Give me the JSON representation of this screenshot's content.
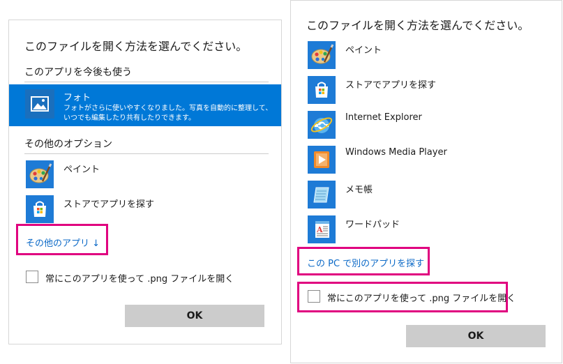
{
  "left_dialog": {
    "title": "このファイルを開く方法を選んでください。",
    "keep_section": "このアプリを今後も使う",
    "selected_app": {
      "name": "フォト",
      "description": "フォトがさらに使いやすくなりました。写真を自動的に整理して、いつでも編集したり共有したりできます。",
      "icon": "photos-icon"
    },
    "other_section": "その他のオプション",
    "apps": [
      {
        "name": "ペイント",
        "icon": "paint-icon"
      },
      {
        "name": "ストアでアプリを探す",
        "icon": "store-icon"
      }
    ],
    "more_apps_link": "その他のアプリ ↓",
    "always_use_label": "常にこのアプリを使って .png ファイルを開く",
    "ok_label": "OK"
  },
  "right_dialog": {
    "title": "このファイルを開く方法を選んでください。",
    "apps": [
      {
        "name": "ペイント",
        "icon": "paint-icon"
      },
      {
        "name": "ストアでアプリを探す",
        "icon": "store-icon"
      },
      {
        "name": "Internet Explorer",
        "icon": "internet-explorer-icon"
      },
      {
        "name": "Windows Media Player",
        "icon": "windows-media-player-icon"
      },
      {
        "name": "メモ帳",
        "icon": "notepad-icon"
      },
      {
        "name": "ワードパッド",
        "icon": "wordpad-icon"
      }
    ],
    "find_other_link": "この PC で別のアプリを探す",
    "always_use_label": "常にこのアプリを使って .png ファイルを開く",
    "ok_label": "OK"
  },
  "colors": {
    "accent": "#0078d7",
    "link": "#0b69c7",
    "highlight": "#e0007f",
    "button": "#cccccc"
  }
}
